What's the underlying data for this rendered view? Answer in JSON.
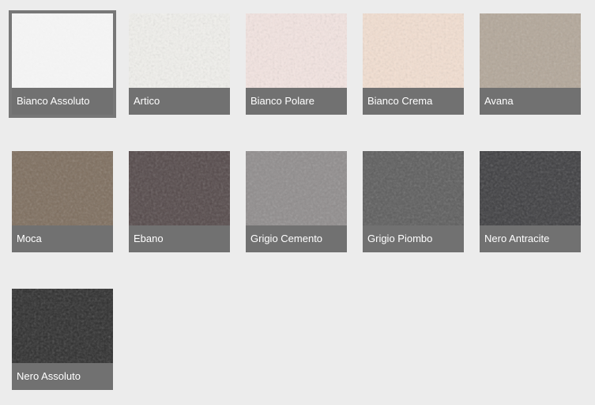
{
  "swatches": [
    {
      "label": "Bianco Assoluto",
      "color": "#f3f3f3",
      "selected": true
    },
    {
      "label": "Artico",
      "color": "#efeeea",
      "selected": false
    },
    {
      "label": "Bianco Polare",
      "color": "#f1e2df",
      "selected": false
    },
    {
      "label": "Bianco Crema",
      "color": "#f0dccf",
      "selected": false
    },
    {
      "label": "Avana",
      "color": "#b0a497",
      "selected": false
    },
    {
      "label": "Moca",
      "color": "#7b6b5b",
      "selected": false
    },
    {
      "label": "Ebano",
      "color": "#514647",
      "selected": false
    },
    {
      "label": "Grigio Cemento",
      "color": "#8d8a8a",
      "selected": false
    },
    {
      "label": "Grigio Piombo",
      "color": "#5a5a5a",
      "selected": false
    },
    {
      "label": "Nero Antracite",
      "color": "#3b3b3d",
      "selected": false
    },
    {
      "label": "Nero Assoluto",
      "color": "#2b2b2b",
      "selected": false
    }
  ]
}
